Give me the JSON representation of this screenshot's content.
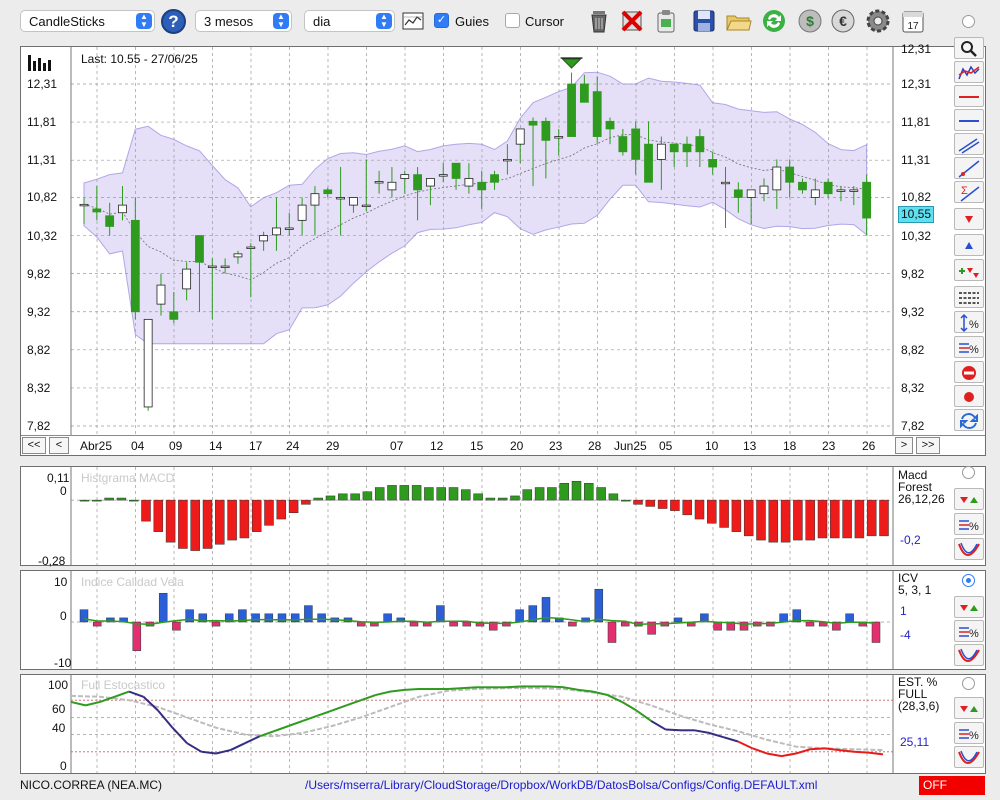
{
  "toolbar": {
    "chart_type": "CandleSticks",
    "period": "3 mesos",
    "interval": "dia",
    "guides_label": "Guies",
    "guides_checked": true,
    "cursor_label": "Cursor",
    "cursor_checked": false,
    "help_label": "?"
  },
  "main_chart": {
    "last_info": "Last: 10.55 - 27/06/25",
    "current_price": "10,55",
    "y_labels": [
      "12,31",
      "11,81",
      "11,31",
      "10,82",
      "10,32",
      "9,82",
      "9,32",
      "8,82",
      "8,32",
      "7,82"
    ],
    "nav": {
      "first": "<<",
      "prev": "<",
      "next": ">",
      "last": ">>"
    },
    "x_labels": [
      "Abr25",
      "04",
      "09",
      "14",
      "17",
      "24",
      "29",
      "07",
      "12",
      "15",
      "20",
      "23",
      "28",
      "Jun25",
      "05",
      "10",
      "13",
      "18",
      "23",
      "26"
    ]
  },
  "macd": {
    "title": "Histgrama MACD",
    "y_labels": [
      "0,11",
      "0",
      "-0,28"
    ],
    "param_lines": [
      "Macd",
      "Forest",
      "26,12,26"
    ],
    "value": "-0,2"
  },
  "icv": {
    "title": "Indice Calidad Vela",
    "y_labels": [
      "10",
      "0",
      "-10"
    ],
    "param_lines": [
      "ICV",
      "5, 3, 1"
    ],
    "value1": "1",
    "value2": "-4"
  },
  "stoch": {
    "title": "Full Estocastico",
    "y_labels": [
      "100",
      "60",
      "40",
      "0"
    ],
    "param_lines": [
      "EST. %",
      "FULL",
      "(28,3,6)"
    ],
    "value": "25,11"
  },
  "status": {
    "ticker": "NICO.CORREA (NEA.MC)",
    "path": "/Users/mserra/Library/CloudStorage/Dropbox/WorkDB/DatosBolsa/Configs/Config.DEFAULT.xml",
    "off_label": "OFF"
  },
  "colors": {
    "up": "#ffffff",
    "down": "#2e9a1e",
    "band_fill": "#dcd6f6",
    "band_line": "#b1a6e6",
    "macd_pos": "#2e9a1e",
    "macd_neg": "#ee1b1b",
    "icv_pos": "#2a5fd8",
    "icv_neg": "#e32f6f",
    "stoch_k": "#2e9a1e",
    "stoch_k_low": "#352d80",
    "stoch_k_oversold": "#e81b1b",
    "stoch_d": "#bcbcbc"
  },
  "chart_data": [
    {
      "type": "candlestick",
      "ylim": [
        7.82,
        12.31
      ],
      "candles": [
        [
          10.73,
          10.82,
          10.47,
          10.73
        ],
        [
          10.67,
          10.97,
          10.52,
          10.63
        ],
        [
          10.58,
          10.75,
          10.32,
          10.44
        ],
        [
          10.62,
          10.97,
          10.52,
          10.72
        ],
        [
          10.52,
          10.82,
          9.22,
          9.32
        ],
        [
          8.07,
          9.22,
          8.02,
          9.22
        ],
        [
          9.42,
          9.82,
          9.27,
          9.67
        ],
        [
          9.32,
          9.58,
          9.17,
          9.22
        ],
        [
          9.62,
          9.97,
          9.47,
          9.88
        ],
        [
          10.32,
          10.32,
          9.32,
          9.97
        ],
        [
          9.92,
          10.02,
          9.22,
          9.92
        ],
        [
          9.92,
          10.02,
          9.82,
          9.92
        ],
        [
          10.04,
          10.12,
          9.95,
          10.08
        ],
        [
          10.17,
          10.22,
          9.51,
          10.17
        ],
        [
          10.25,
          10.37,
          10.12,
          10.32
        ],
        [
          10.33,
          10.82,
          10.12,
          10.42
        ],
        [
          10.42,
          10.62,
          10.32,
          10.42
        ],
        [
          10.52,
          10.82,
          10.32,
          10.72
        ],
        [
          10.72,
          10.97,
          10.32,
          10.87
        ],
        [
          10.92,
          10.95,
          10.82,
          10.87
        ],
        [
          10.82,
          11.22,
          10.32,
          10.82
        ],
        [
          10.72,
          10.82,
          10.62,
          10.82
        ],
        [
          10.72,
          11.32,
          10.64,
          10.72
        ],
        [
          11.03,
          11.17,
          10.87,
          11.03
        ],
        [
          10.92,
          11.22,
          10.82,
          11.02
        ],
        [
          11.07,
          11.17,
          10.87,
          11.12
        ],
        [
          11.12,
          11.22,
          10.52,
          10.92
        ],
        [
          10.97,
          11.07,
          10.72,
          11.07
        ],
        [
          11.12,
          11.27,
          11.02,
          11.12
        ],
        [
          11.27,
          11.27,
          10.92,
          11.07
        ],
        [
          10.97,
          11.27,
          10.87,
          11.07
        ],
        [
          11.02,
          11.17,
          10.67,
          10.92
        ],
        [
          11.12,
          11.17,
          10.92,
          11.02
        ],
        [
          11.32,
          11.52,
          11.12,
          11.32
        ],
        [
          11.52,
          11.72,
          11.27,
          11.72
        ],
        [
          11.82,
          11.87,
          10.97,
          11.77
        ],
        [
          11.82,
          11.87,
          11.07,
          11.57
        ],
        [
          11.62,
          11.72,
          11.37,
          11.62
        ],
        [
          12.31,
          12.46,
          11.62,
          11.62
        ],
        [
          12.31,
          12.43,
          12.07,
          12.07
        ],
        [
          12.21,
          12.41,
          11.53,
          11.62
        ],
        [
          11.82,
          11.87,
          11.52,
          11.72
        ],
        [
          11.62,
          11.72,
          11.37,
          11.42
        ],
        [
          11.72,
          11.82,
          11.12,
          11.32
        ],
        [
          11.52,
          11.82,
          11.17,
          11.02
        ],
        [
          11.32,
          11.62,
          10.92,
          11.52
        ],
        [
          11.52,
          11.52,
          11.22,
          11.42
        ],
        [
          11.52,
          11.62,
          11.22,
          11.42
        ],
        [
          11.62,
          11.72,
          11.22,
          11.42
        ],
        [
          11.32,
          11.42,
          11.12,
          11.22
        ],
        [
          11.02,
          11.22,
          10.42,
          11.02
        ],
        [
          10.92,
          11.02,
          10.62,
          10.82
        ],
        [
          10.82,
          10.92,
          10.47,
          10.92
        ],
        [
          10.87,
          11.07,
          10.77,
          10.97
        ],
        [
          10.92,
          11.32,
          10.67,
          11.22
        ],
        [
          11.22,
          11.32,
          10.82,
          11.02
        ],
        [
          11.02,
          11.07,
          10.87,
          10.92
        ],
        [
          10.82,
          11.07,
          10.72,
          10.92
        ],
        [
          11.02,
          11.07,
          10.82,
          10.87
        ],
        [
          10.92,
          10.97,
          10.77,
          10.92
        ],
        [
          10.92,
          10.97,
          10.72,
          10.92
        ],
        [
          11.02,
          11.12,
          10.32,
          10.55
        ]
      ],
      "marker_index": 38
    },
    {
      "type": "bar",
      "name": "Histgrama MACD",
      "ylim": [
        -0.28,
        0.11
      ],
      "values": [
        0,
        0,
        0.01,
        0.01,
        0,
        -0.1,
        -0.15,
        -0.2,
        -0.23,
        -0.24,
        -0.23,
        -0.21,
        -0.19,
        -0.18,
        -0.15,
        -0.12,
        -0.09,
        -0.06,
        -0.02,
        0.01,
        0.02,
        0.03,
        0.03,
        0.04,
        0.06,
        0.07,
        0.07,
        0.07,
        0.06,
        0.06,
        0.06,
        0.05,
        0.03,
        0.01,
        0.01,
        0.02,
        0.05,
        0.06,
        0.06,
        0.08,
        0.09,
        0.08,
        0.06,
        0.03,
        0,
        -0.02,
        -0.03,
        -0.04,
        -0.05,
        -0.07,
        -0.09,
        -0.11,
        -0.13,
        -0.15,
        -0.17,
        -0.19,
        -0.2,
        -0.2,
        -0.19,
        -0.19,
        -0.18,
        -0.18,
        -0.18,
        -0.18,
        -0.17,
        -0.17,
        -0.2
      ]
    },
    {
      "type": "bar",
      "name": "Indice Calidad Vela",
      "ylim": [
        -10,
        10
      ],
      "values": [
        3,
        -1,
        1,
        1,
        -7,
        -1,
        7,
        -2,
        3,
        2,
        -1,
        2,
        3,
        2,
        2,
        2,
        2,
        4,
        2,
        1,
        1,
        -1,
        -1,
        2,
        1,
        -1,
        -1,
        4,
        -1,
        -1,
        -1,
        -2,
        -1,
        3,
        4,
        6,
        1,
        -1,
        1,
        8,
        -5,
        -1,
        -1,
        -3,
        -1,
        1,
        -1,
        2,
        -2,
        -2,
        -2,
        -1,
        -1,
        2,
        3,
        -1,
        -1,
        -2,
        2,
        -1,
        -5
      ]
    },
    {
      "type": "line",
      "name": "Full Estocastico",
      "ylim": [
        0,
        100
      ],
      "k": [
        [
          0,
          78
        ],
        [
          2,
          74
        ],
        [
          4,
          78
        ],
        [
          6,
          84
        ],
        [
          8,
          90
        ],
        [
          10,
          84
        ],
        [
          12,
          68
        ],
        [
          14,
          48
        ],
        [
          16,
          30
        ],
        [
          18,
          20
        ],
        [
          20,
          18
        ],
        [
          22,
          22
        ],
        [
          24,
          30
        ],
        [
          26,
          38
        ],
        [
          28,
          44
        ],
        [
          30,
          50
        ],
        [
          32,
          56
        ],
        [
          34,
          62
        ],
        [
          36,
          68
        ],
        [
          38,
          74
        ],
        [
          40,
          80
        ],
        [
          42,
          86
        ],
        [
          44,
          90
        ],
        [
          46,
          92
        ],
        [
          48,
          93
        ],
        [
          50,
          93
        ],
        [
          52,
          93
        ],
        [
          54,
          94
        ],
        [
          56,
          95
        ],
        [
          58,
          95
        ],
        [
          60,
          95
        ],
        [
          62,
          96
        ],
        [
          64,
          96
        ],
        [
          66,
          96
        ],
        [
          68,
          95
        ],
        [
          70,
          92
        ],
        [
          72,
          90
        ],
        [
          74,
          86
        ],
        [
          76,
          78
        ],
        [
          78,
          68
        ],
        [
          80,
          56
        ],
        [
          82,
          46
        ],
        [
          84,
          45
        ],
        [
          86,
          45
        ],
        [
          88,
          42
        ],
        [
          90,
          37
        ],
        [
          92,
          32
        ],
        [
          94,
          24
        ],
        [
          96,
          18
        ],
        [
          98,
          15
        ],
        [
          100,
          18
        ],
        [
          102,
          23
        ],
        [
          104,
          24
        ],
        [
          106,
          22
        ],
        [
          108,
          20
        ],
        [
          110,
          19
        ],
        [
          112,
          17
        ]
      ],
      "d": [
        [
          0,
          85
        ],
        [
          4,
          84
        ],
        [
          8,
          80
        ],
        [
          12,
          72
        ],
        [
          16,
          60
        ],
        [
          20,
          48
        ],
        [
          24,
          40
        ],
        [
          28,
          38
        ],
        [
          32,
          42
        ],
        [
          36,
          50
        ],
        [
          40,
          60
        ],
        [
          44,
          72
        ],
        [
          48,
          84
        ],
        [
          52,
          91
        ],
        [
          56,
          93
        ],
        [
          60,
          94
        ],
        [
          64,
          94
        ],
        [
          68,
          93
        ],
        [
          72,
          89
        ],
        [
          76,
          84
        ],
        [
          80,
          74
        ],
        [
          84,
          62
        ],
        [
          88,
          52
        ],
        [
          92,
          44
        ],
        [
          96,
          34
        ],
        [
          100,
          26
        ],
        [
          104,
          24
        ],
        [
          108,
          23
        ],
        [
          112,
          22
        ]
      ],
      "levels": [
        80,
        20
      ]
    }
  ]
}
